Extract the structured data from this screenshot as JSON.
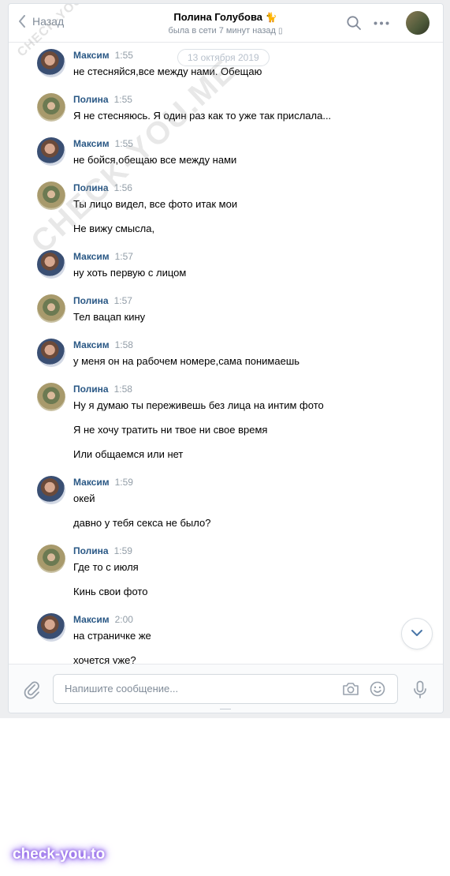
{
  "header": {
    "back_label": "Назад",
    "contact_name": "Полина Голубова",
    "contact_emoji": "🐈",
    "status": "была в сети 7 минут назад",
    "status_device_glyph": "▯",
    "icons": {
      "back": "chevron-left-icon",
      "search": "search-icon",
      "more": "more-horizontal-icon"
    }
  },
  "date_divider": "13 октября 2019",
  "messages": [
    {
      "author": "Максим",
      "time": "1:55",
      "lines": [
        "не стесняйся,все между нами. Обещаю"
      ]
    },
    {
      "author": "Полина",
      "time": "1:55",
      "lines": [
        "Я не стесняюсь. Я один раз как то уже так прислала..."
      ]
    },
    {
      "author": "Максим",
      "time": "1:55",
      "lines": [
        "не бойся,обещаю все между нами"
      ]
    },
    {
      "author": "Полина",
      "time": "1:56",
      "lines": [
        "Ты лицо видел, все фото итак мои",
        "Не вижу смысла,"
      ]
    },
    {
      "author": "Максим",
      "time": "1:57",
      "lines": [
        "ну хоть первую с лицом"
      ]
    },
    {
      "author": "Полина",
      "time": "1:57",
      "lines": [
        "Тел вацап кину"
      ]
    },
    {
      "author": "Максим",
      "time": "1:58",
      "lines": [
        "у меня он на рабочем номере,сама понимаешь"
      ]
    },
    {
      "author": "Полина",
      "time": "1:58",
      "lines": [
        "Ну я думаю ты переживешь без лица на интим фото",
        "Я не хочу тратить ни твое ни свое время",
        "Или общаемся или нет"
      ]
    },
    {
      "author": "Максим",
      "time": "1:59",
      "lines": [
        "окей",
        "давно у тебя секса не было?"
      ]
    },
    {
      "author": "Полина",
      "time": "1:59",
      "lines": [
        "Где то с июля",
        "Кинь свои фото"
      ]
    },
    {
      "author": "Максим",
      "time": "2:00",
      "lines": [
        "на страничке же",
        "хочется уже?"
      ]
    }
  ],
  "composer": {
    "placeholder": "Напишите сообщение...",
    "icons": {
      "attach": "paperclip-icon",
      "camera": "camera-icon",
      "emoji": "smile-icon",
      "mic": "microphone-icon"
    }
  },
  "watermarks": {
    "diagonal": "CHECK-YOU.ME",
    "brand": "check-you.to"
  },
  "colors": {
    "author_link": "#2a5885",
    "muted": "#818c99",
    "time": "#939ea8",
    "brand_glow": "#7b4be0"
  }
}
